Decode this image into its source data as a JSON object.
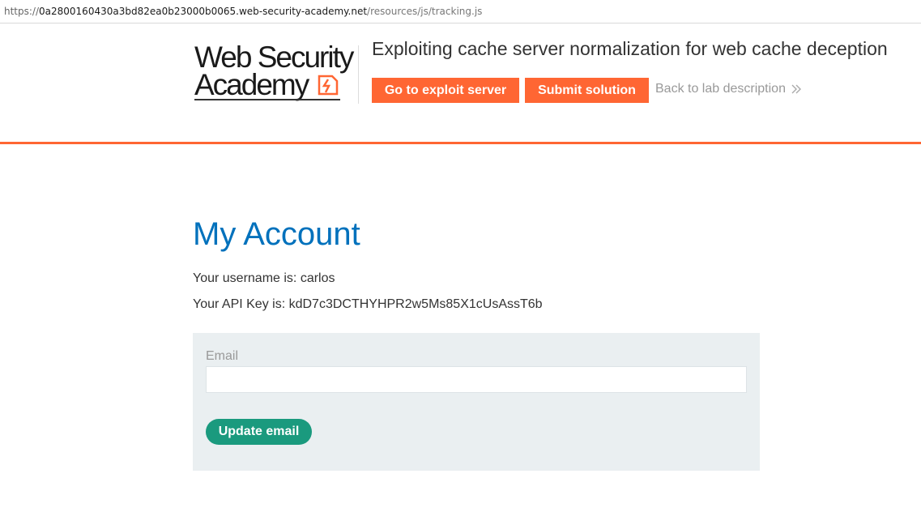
{
  "browser": {
    "url_scheme": "https://",
    "url_host": "0a2800160430a3bd82ea0b23000b0065.web-security-academy.net",
    "url_path": "/resources/js/tracking.js"
  },
  "header": {
    "logo_line1": "Web Security",
    "logo_line2": "Academy",
    "lab_title": "Exploiting cache server normalization for web cache deception",
    "exploit_button": "Go to exploit server",
    "submit_button": "Submit solution",
    "back_link": "Back to lab description",
    "back_icon": "double-chevron-right-icon",
    "accent_color": "#ff6633"
  },
  "main": {
    "title": "My Account",
    "username_line": "Your username is: carlos",
    "apikey_line": "Your API Key is: kdD7c3DCTHYHPR2w5Ms85X1cUsAssT6b",
    "form": {
      "email_label": "Email",
      "email_value": "",
      "update_button": "Update email"
    },
    "title_color": "#0071bc",
    "button_color": "#1a9a7e"
  }
}
